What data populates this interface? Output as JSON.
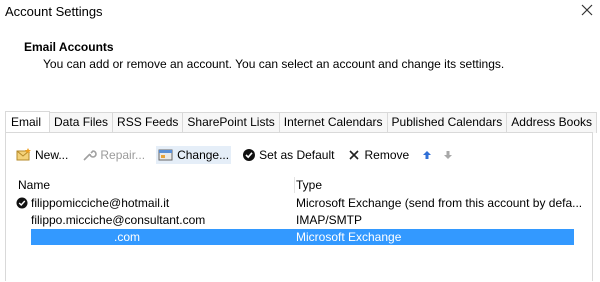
{
  "window": {
    "title": "Account Settings"
  },
  "header": {
    "title": "Email Accounts",
    "description": "You can add or remove an account. You can select an account and change its settings."
  },
  "tabs": [
    {
      "label": "Email",
      "active": true
    },
    {
      "label": "Data Files"
    },
    {
      "label": "RSS Feeds"
    },
    {
      "label": "SharePoint Lists"
    },
    {
      "label": "Internet Calendars"
    },
    {
      "label": "Published Calendars"
    },
    {
      "label": "Address Books"
    }
  ],
  "toolbar": {
    "new_label": "New...",
    "repair_label": "Repair...",
    "change_label": "Change...",
    "default_label": "Set as Default",
    "remove_label": "Remove"
  },
  "list": {
    "columns": {
      "name": "Name",
      "type": "Type"
    },
    "rows": [
      {
        "name": "filippomicciche@hotmail.it",
        "type": "Microsoft Exchange (send from this account by defa...",
        "default": true
      },
      {
        "name": "filippo.micciche@consultant.com",
        "type": "IMAP/SMTP",
        "default": false
      },
      {
        "name": ".com",
        "type": "Microsoft Exchange",
        "default": false,
        "selected": true
      }
    ]
  },
  "colors": {
    "selection": "#3399ff",
    "arrow_blue": "#2f6fd6"
  }
}
